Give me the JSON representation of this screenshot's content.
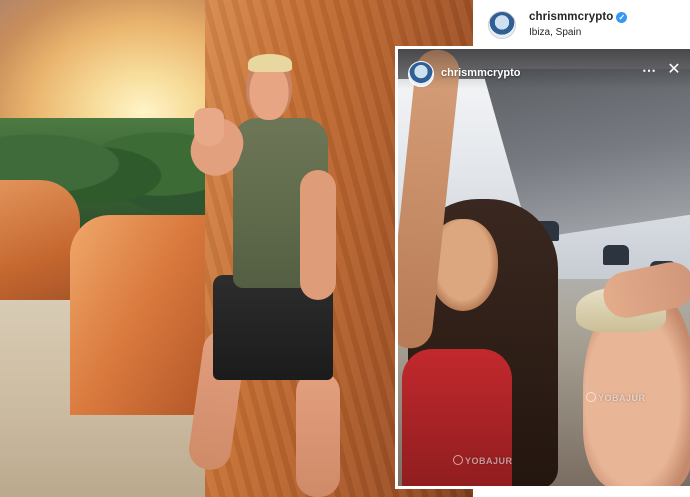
{
  "profile": {
    "username": "chrismmcrypto",
    "location": "Ibiza, Spain",
    "verified_icon": "verified-badge-icon"
  },
  "story": {
    "username": "chrismmcrypto",
    "more_icon": "more-options-icon",
    "close_icon": "close-icon",
    "watermark_1": "YOBAJUR",
    "watermark_2": "YOBAJUR"
  },
  "colors": {
    "verified": "#3897f0",
    "header_text": "#262626",
    "story_text": "#ffffff"
  }
}
